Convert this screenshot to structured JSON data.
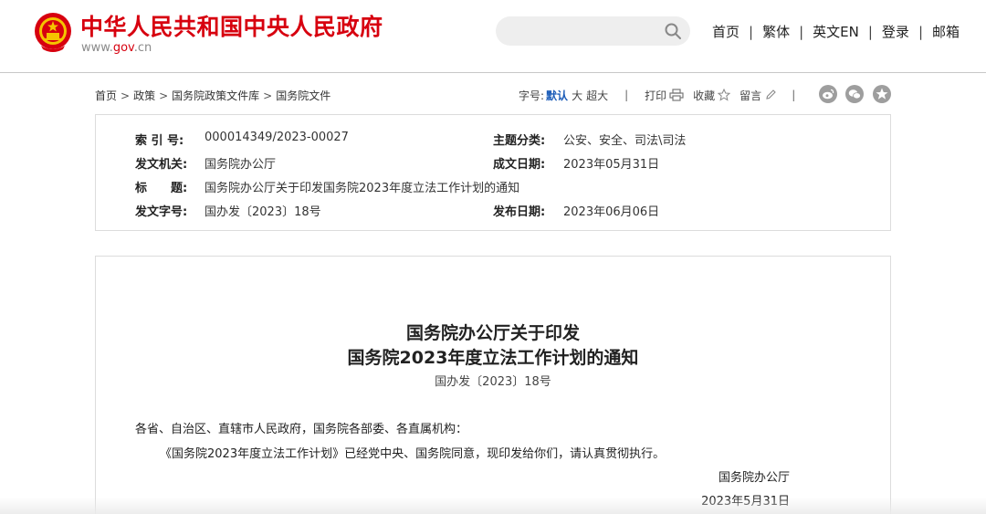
{
  "header": {
    "site_title": "中华人民共和国中央人民政府",
    "site_domain_prefix": "www.",
    "site_domain_accent": "gov",
    "site_domain_suffix": ".cn",
    "search": {
      "placeholder": "",
      "value": ""
    },
    "nav": [
      "首页",
      "繁体",
      "英文EN",
      "登录",
      "邮箱"
    ],
    "nav_separator": "|"
  },
  "breadcrumb": {
    "items": [
      "首页",
      "政策",
      "国务院政策文件库",
      "国务院文件"
    ],
    "separator": ">"
  },
  "toolbar": {
    "font_size_label": "字号:",
    "font_size_options": [
      "默认",
      "大",
      "超大"
    ],
    "font_size_active": "默认",
    "separator": "|",
    "print_label": "打印",
    "favorite_label": "收藏",
    "comment_label": "留言",
    "share_icons": [
      "weibo-icon",
      "wechat-icon",
      "qzone-star-icon"
    ]
  },
  "info": {
    "index_no_label": "索 引 号:",
    "index_no": "000014349/2023-00027",
    "topic_label": "主题分类:",
    "topic": "公安、安全、司法\\司法",
    "issuer_label": "发文机关:",
    "issuer": "国务院办公厅",
    "written_date_label": "成文日期:",
    "written_date": "2023年05月31日",
    "title_label": "标　　题:",
    "title": "国务院办公厅关于印发国务院2023年度立法工作计划的通知",
    "doc_no_label": "发文字号:",
    "doc_no": "国办发〔2023〕18号",
    "publish_date_label": "发布日期:",
    "publish_date": "2023年06月06日"
  },
  "document": {
    "title_line1": "国务院办公厅关于印发",
    "title_line2": "国务院2023年度立法工作计划的通知",
    "number": "国办发〔2023〕18号",
    "salutation": "各省、自治区、直辖市人民政府，国务院各部委、各直属机构：",
    "body": "《国务院2023年度立法工作计划》已经党中央、国务院同意，现印发给你们，请认真贯彻执行。",
    "signature": "国务院办公厅",
    "date": "2023年5月31日"
  },
  "colors": {
    "brand_red": "#d7000f",
    "active_blue": "#1b5cb8",
    "border_gray": "#dcdcdc"
  }
}
